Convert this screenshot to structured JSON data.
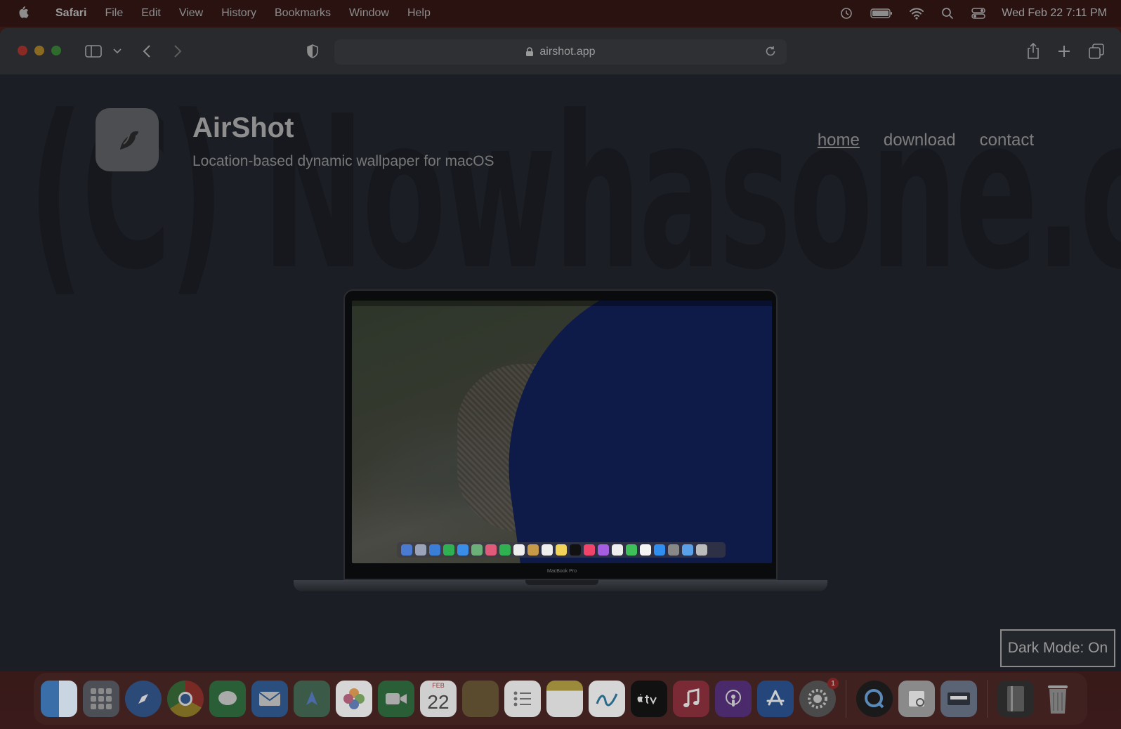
{
  "menubar": {
    "apple_icon": "apple-icon",
    "app_name": "Safari",
    "items": [
      "File",
      "Edit",
      "View",
      "History",
      "Bookmarks",
      "Window",
      "Help"
    ],
    "clock": "Wed Feb 22  7:11 PM"
  },
  "safari": {
    "url": "airshot.app"
  },
  "site": {
    "watermark": "(C) Nowhasone.com",
    "title": "AirShot",
    "subtitle": "Location-based dynamic wallpaper for macOS",
    "nav": [
      "home",
      "download",
      "contact"
    ],
    "active_nav": "home",
    "laptop_label": "MacBook Pro",
    "dark_mode_toggle": "Dark Mode: On"
  },
  "dock": {
    "calendar_month": "FEB",
    "calendar_day": "22",
    "settings_badge": "1"
  },
  "colors": {
    "window_bg": "#1d2026",
    "toolbar_bg": "#282a2e",
    "menubar_bg": "#281210"
  }
}
